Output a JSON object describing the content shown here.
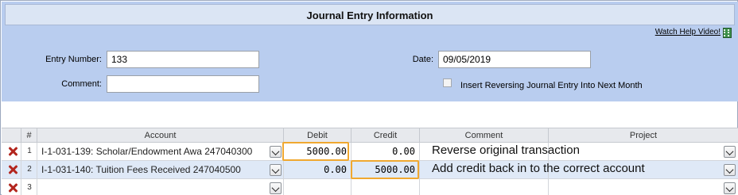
{
  "header": {
    "title": "Journal Entry Information",
    "help_link": "Watch Help Video!"
  },
  "form": {
    "entry_number_label": "Entry Number:",
    "entry_number_value": "133",
    "comment_label": "Comment:",
    "comment_value": "",
    "date_label": "Date:",
    "date_value": "09/05/2019",
    "reversing_label": "Insert Reversing Journal Entry Into Next Month",
    "reversing_checked": false
  },
  "grid": {
    "columns": [
      "#",
      "Account",
      "Debit",
      "Credit",
      "Comment",
      "Project"
    ],
    "rows": [
      {
        "num": "1",
        "account": "I-1-031-139: Scholar/Endowment Awa 247040300",
        "debit": "5000.00",
        "credit": "0.00",
        "comment": "Reverse original transaction"
      },
      {
        "num": "2",
        "account": "I-1-031-140: Tuition Fees Received 247040500",
        "debit": "0.00",
        "credit": "5000.00",
        "comment": "Add credit back in to the correct account"
      },
      {
        "num": "3",
        "account": "",
        "debit": "",
        "credit": "",
        "comment": ""
      }
    ]
  },
  "colors": {
    "header_bg": "#b9cdef",
    "title_bg": "#dbe5f4",
    "highlight": "#f0a830",
    "delete_icon": "#b3261e"
  },
  "icons": [
    "film-icon",
    "delete-icon",
    "chevron-down-icon"
  ]
}
